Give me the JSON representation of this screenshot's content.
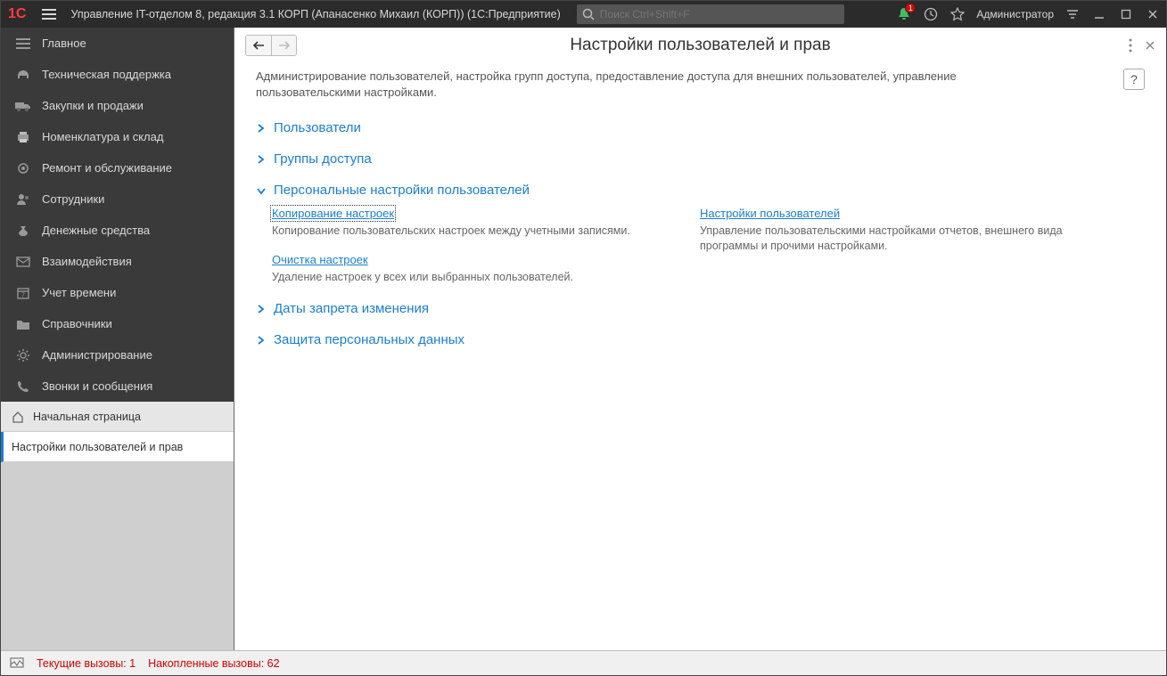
{
  "titlebar": {
    "app_title": "Управление IT-отделом 8, редакция 3.1 КОРП (Апанасенко Михаил (КОРП))  (1С:Предприятие)",
    "search_placeholder": "Поиск Ctrl+Shift+F",
    "notification_count": "1",
    "admin_label": "Администратор"
  },
  "sidebar": {
    "items": [
      {
        "label": "Главное"
      },
      {
        "label": "Техническая поддержка"
      },
      {
        "label": "Закупки и продажи"
      },
      {
        "label": "Номенклатура и склад"
      },
      {
        "label": "Ремонт и обслуживание"
      },
      {
        "label": "Сотрудники"
      },
      {
        "label": "Денежные средства"
      },
      {
        "label": "Взаимодействия"
      },
      {
        "label": "Учет времени"
      },
      {
        "label": "Справочники"
      },
      {
        "label": "Администрирование"
      },
      {
        "label": "Звонки и сообщения"
      }
    ],
    "tabs": [
      {
        "label": "Начальная страница"
      },
      {
        "label": "Настройки пользователей и прав"
      }
    ]
  },
  "content": {
    "page_title": "Настройки пользователей и прав",
    "help_char": "?",
    "description": "Администрирование пользователей, настройка групп доступа, предоставление доступа для внешних пользователей, управление пользовательскими настройками.",
    "sections": {
      "users": "Пользователи",
      "access_groups": "Группы доступа",
      "personal": "Персональные настройки пользователей",
      "dates": "Даты запрета изменения",
      "protection": "Защита персональных данных"
    },
    "personal_block": {
      "copy_link": "Копирование настроек",
      "copy_desc": "Копирование пользовательских настроек между учетными записями.",
      "user_settings_link": "Настройки пользователей",
      "user_settings_desc": "Управление пользовательскими настройками отчетов, внешнего вида программы и прочими настройками.",
      "clear_link": "Очистка настроек",
      "clear_desc": "Удаление настроек у всех или выбранных пользователей."
    }
  },
  "statusbar": {
    "current_calls": "Текущие вызовы: 1",
    "accumulated_calls": "Накопленные вызовы: 62"
  }
}
